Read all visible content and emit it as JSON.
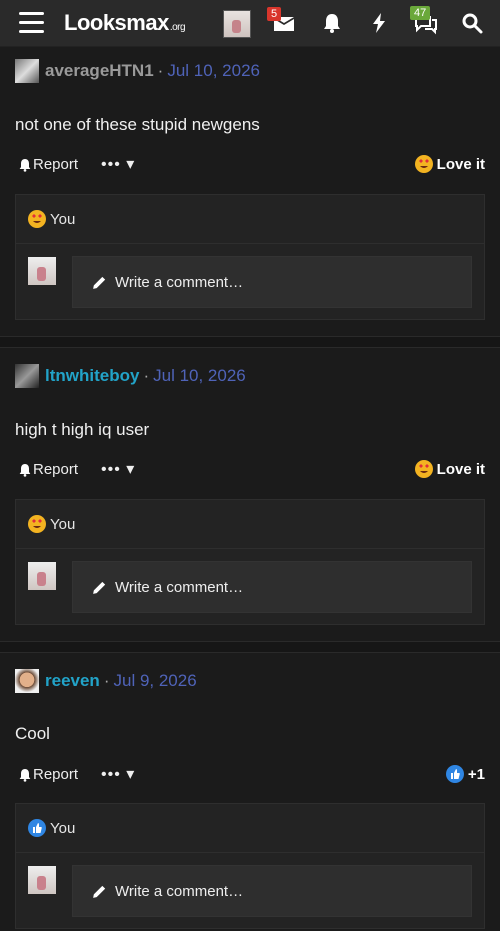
{
  "header": {
    "logo_text": "Looksmax",
    "logo_suffix": ".org",
    "inbox_badge": "5",
    "alerts_badge": "47"
  },
  "posts": [
    {
      "username": "averageHTN1",
      "username_color": "#9a9a9a",
      "date": "Jul 10, 2026",
      "message": "not one of these stupid newgens",
      "report_label": "Report",
      "reaction_label": "Love it",
      "reaction_icon": "heart-eyes-emoji",
      "you_reaction_icon": "heart-eyes-emoji",
      "you_label": "You",
      "comment_placeholder": "Write a comment…"
    },
    {
      "username": "ltnwhiteboy",
      "username_color": "#22a3c8",
      "date": "Jul 10, 2026",
      "message": "high t high iq user",
      "report_label": "Report",
      "reaction_label": "Love it",
      "reaction_icon": "heart-eyes-emoji",
      "you_reaction_icon": "heart-eyes-emoji",
      "you_label": "You",
      "comment_placeholder": "Write a comment…"
    },
    {
      "username": "reeven",
      "username_color": "#22a3c8",
      "date": "Jul 9, 2026",
      "message": "Cool",
      "report_label": "Report",
      "reaction_label": "+1",
      "reaction_icon": "thumbs-up-emoji",
      "you_reaction_icon": "thumbs-up-emoji",
      "you_label": "You",
      "comment_placeholder": "Write a comment…"
    }
  ],
  "colors": {
    "date": "#4f63b8",
    "inbox_badge": "#d9362c",
    "alerts_badge": "#6aa83a"
  }
}
